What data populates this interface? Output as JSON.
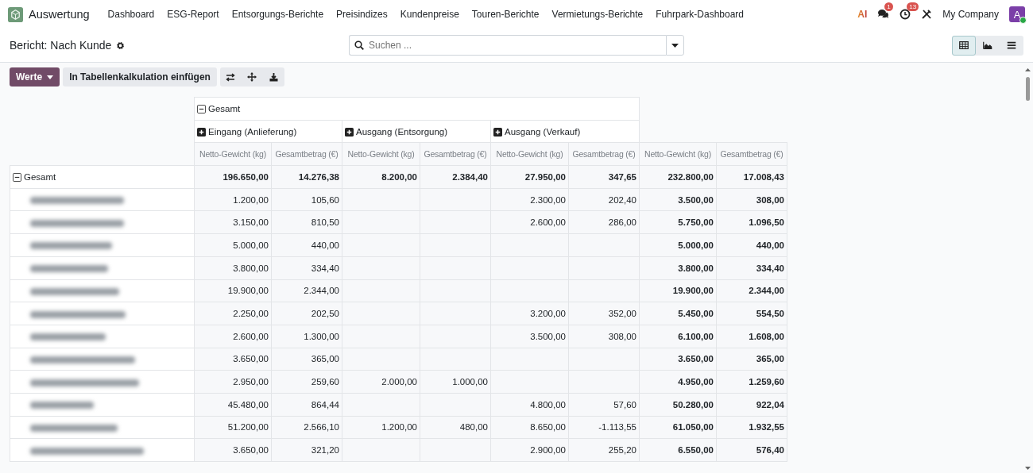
{
  "app": {
    "name": "Auswertung"
  },
  "nav": [
    "Dashboard",
    "ESG-Report",
    "Entsorgungs-Berichte",
    "Preisindizes",
    "Kundenpreise",
    "Touren-Berichte",
    "Vermietungs-Berichte",
    "Fuhrpark-Dashboard"
  ],
  "systray": {
    "ai_label": "AI",
    "chat_badge": "1",
    "activity_badge": "13",
    "company": "My Company",
    "avatar": "A"
  },
  "breadcrumb": {
    "title": "Bericht: Nach Kunde"
  },
  "search": {
    "placeholder": "Suchen ..."
  },
  "views": [
    {
      "kind": "pivot",
      "selected": true
    },
    {
      "kind": "graph",
      "selected": false
    },
    {
      "kind": "list",
      "selected": false
    }
  ],
  "toolbar": {
    "measures_button": "Werte",
    "insert_button": "In Tabellenkalkulation einfügen"
  },
  "pivot": {
    "col_total": {
      "label": "Gesamt",
      "expanded": true
    },
    "col_groups": [
      {
        "label": "Eingang (Anlieferung)",
        "expanded": false
      },
      {
        "label": "Ausgang (Entsorgung)",
        "expanded": false
      },
      {
        "label": "Ausgang (Verkauf)",
        "expanded": false
      }
    ],
    "measures": [
      "Netto-Gewicht (kg)",
      "Gesamtbetrag (€)",
      "Netto-Gewicht (kg)",
      "Gesamtbetrag (€)",
      "Netto-Gewicht (kg)",
      "Gesamtbetrag (€)",
      "Netto-Gewicht (kg)",
      "Gesamtbetrag (€)"
    ],
    "row_total": {
      "label": "Gesamt",
      "expanded": true,
      "eingang_gewicht": "196.650,00",
      "eingang_betrag": "14.276,38",
      "entsorgung_gewicht": "8.200,00",
      "entsorgung_betrag": "2.384,40",
      "verkauf_gewicht": "27.950,00",
      "verkauf_betrag": "347,65",
      "total_gewicht": "232.800,00",
      "total_betrag": "17.008,43"
    },
    "rows": [
      {
        "eingang_gewicht": "1.200,00",
        "eingang_betrag": "105,60",
        "verkauf_gewicht": "2.300,00",
        "verkauf_betrag": "202,40",
        "total_gewicht": "3.500,00",
        "total_betrag": "308,00"
      },
      {
        "eingang_gewicht": "3.150,00",
        "eingang_betrag": "810,50",
        "verkauf_gewicht": "2.600,00",
        "verkauf_betrag": "286,00",
        "total_gewicht": "5.750,00",
        "total_betrag": "1.096,50"
      },
      {
        "eingang_gewicht": "5.000,00",
        "eingang_betrag": "440,00",
        "total_gewicht": "5.000,00",
        "total_betrag": "440,00"
      },
      {
        "eingang_gewicht": "3.800,00",
        "eingang_betrag": "334,40",
        "total_gewicht": "3.800,00",
        "total_betrag": "334,40"
      },
      {
        "eingang_gewicht": "19.900,00",
        "eingang_betrag": "2.344,00",
        "total_gewicht": "19.900,00",
        "total_betrag": "2.344,00"
      },
      {
        "eingang_gewicht": "2.250,00",
        "eingang_betrag": "202,50",
        "verkauf_gewicht": "3.200,00",
        "verkauf_betrag": "352,00",
        "total_gewicht": "5.450,00",
        "total_betrag": "554,50"
      },
      {
        "eingang_gewicht": "2.600,00",
        "eingang_betrag": "1.300,00",
        "verkauf_gewicht": "3.500,00",
        "verkauf_betrag": "308,00",
        "total_gewicht": "6.100,00",
        "total_betrag": "1.608,00"
      },
      {
        "eingang_gewicht": "3.650,00",
        "eingang_betrag": "365,00",
        "total_gewicht": "3.650,00",
        "total_betrag": "365,00"
      },
      {
        "eingang_gewicht": "2.950,00",
        "eingang_betrag": "259,60",
        "entsorgung_gewicht": "2.000,00",
        "entsorgung_betrag": "1.000,00",
        "total_gewicht": "4.950,00",
        "total_betrag": "1.259,60"
      },
      {
        "eingang_gewicht": "45.480,00",
        "eingang_betrag": "864,44",
        "verkauf_gewicht": "4.800,00",
        "verkauf_betrag": "57,60",
        "total_gewicht": "50.280,00",
        "total_betrag": "922,04"
      },
      {
        "eingang_gewicht": "51.200,00",
        "eingang_betrag": "2.566,10",
        "entsorgung_gewicht": "1.200,00",
        "entsorgung_betrag": "480,00",
        "verkauf_gewicht": "8.650,00",
        "verkauf_betrag": "-1.113,55",
        "total_gewicht": "61.050,00",
        "total_betrag": "1.932,55"
      },
      {
        "eingang_gewicht": "3.650,00",
        "eingang_betrag": "321,20",
        "verkauf_gewicht": "2.900,00",
        "verkauf_betrag": "255,20",
        "total_gewicht": "6.550,00",
        "total_betrag": "576,40"
      }
    ]
  }
}
